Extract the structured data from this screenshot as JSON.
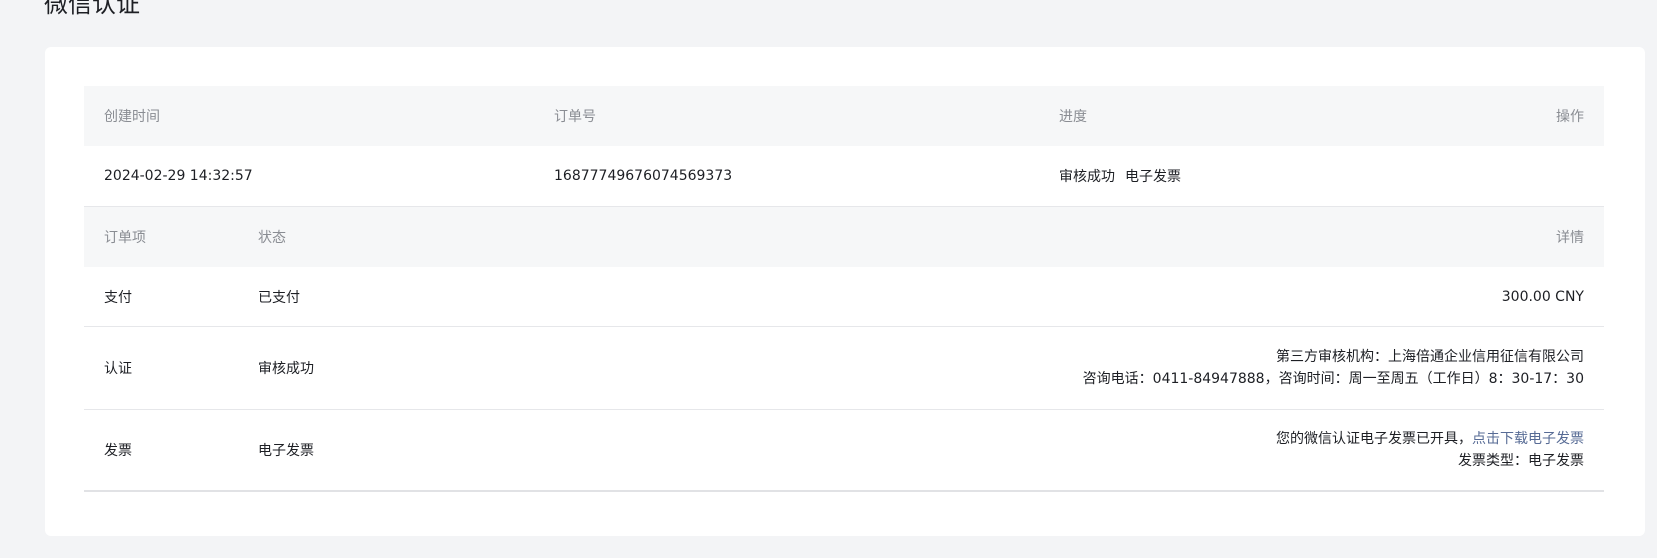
{
  "page": {
    "title": "微信认证"
  },
  "order_table": {
    "headers": {
      "created_time": "创建时间",
      "order_no": "订单号",
      "progress": "进度",
      "action": "操作"
    },
    "order": {
      "created_time": "2024-02-29 14:32:57",
      "order_no": "16877749676074569373",
      "progress_status": "审核成功",
      "progress_invoice": "电子发票"
    }
  },
  "items_table": {
    "headers": {
      "item": "订单项",
      "status": "状态",
      "detail": "详情"
    },
    "rows": [
      {
        "item": "支付",
        "status": "已支付",
        "detail_line1": "300.00 CNY"
      },
      {
        "item": "认证",
        "status": "审核成功",
        "detail_line1": "第三方审核机构：上海倍通企业信用征信有限公司",
        "detail_line2": "咨询电话：0411-84947888，咨询时间：周一至周五（工作日）8：30-17：30"
      },
      {
        "item": "发票",
        "status": "电子发票",
        "detail_line1_prefix": "您的微信认证电子发票已开具，",
        "detail_line1_link": "点击下载电子发票",
        "detail_line2": "发票类型：电子发票"
      }
    ]
  },
  "colors": {
    "background": "#f3f4f6",
    "card": "#ffffff",
    "header_bg": "#f6f7f8",
    "header_text": "#8a8d93",
    "link": "#576b95"
  }
}
